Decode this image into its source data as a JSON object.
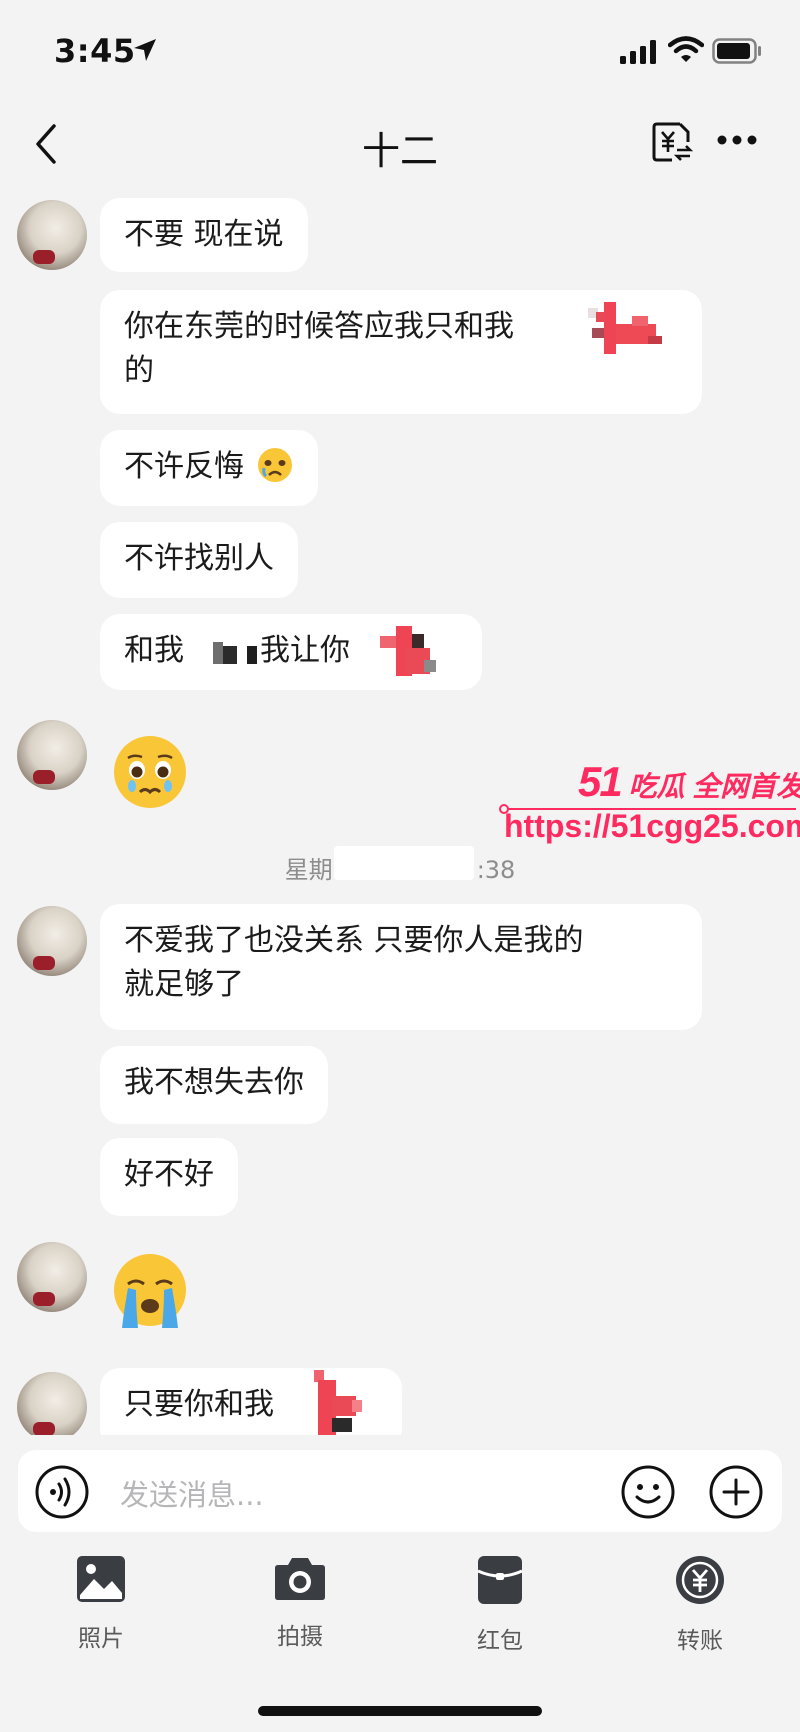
{
  "status_bar": {
    "time": "3:45"
  },
  "header": {
    "title": "十二"
  },
  "messages": {
    "m1": "不要 现在说",
    "m2_line1": "你在东莞的时候答应我只和我",
    "m2_line2": "的",
    "m3": "不许反悔",
    "m4": "不许找别人",
    "m5_part1": "和我",
    "m5_part2": "我让你",
    "timestamp_prefix": "星期",
    "timestamp_suffix": ":38",
    "m6_line1": "不爱我了也没关系 只要你人是我的",
    "m6_line2": "就足够了",
    "m7": "我不想失去你",
    "m8": "好不好",
    "m9": "只要你和我"
  },
  "watermark": {
    "brand_num": "51",
    "brand_text": "吃瓜 全网首发",
    "url": "https://51cgg25.com"
  },
  "input": {
    "placeholder": "发送消息..."
  },
  "toolbar": {
    "photo_label": "照片",
    "camera_label": "拍摄",
    "red_packet_label": "红包",
    "transfer_label": "转账"
  },
  "colors": {
    "background": "#f3f3f4",
    "bubble": "#ffffff",
    "watermark": "#ff2a5f"
  }
}
